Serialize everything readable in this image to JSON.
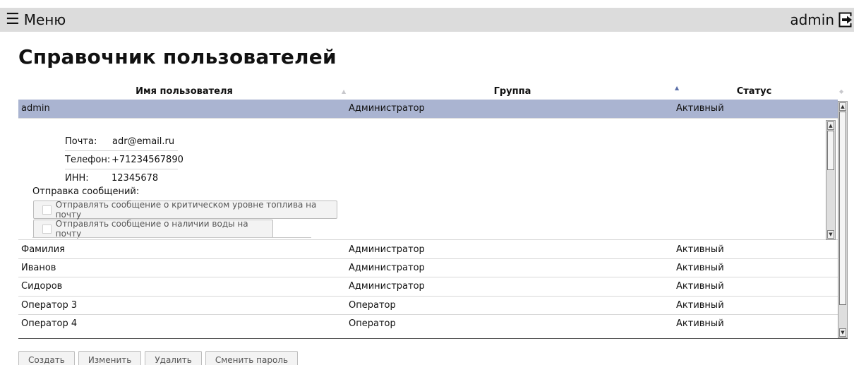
{
  "header": {
    "menu_icon": "☰",
    "menu_label": "Меню",
    "username": "admin",
    "logout_icon": "logout-icon"
  },
  "page_title": "Справочник пользователей",
  "table": {
    "columns": [
      "Имя пользователя",
      "Группа",
      "Статус"
    ],
    "sorted_by": "Статус",
    "rows": [
      {
        "name": "admin",
        "group": "Администратор",
        "status": "Активный",
        "selected": true
      },
      {
        "name": "Фамилия",
        "group": "Администратор",
        "status": "Активный"
      },
      {
        "name": "Иванов",
        "group": "Администратор",
        "status": "Активный"
      },
      {
        "name": "Сидоров",
        "group": "Администратор",
        "status": "Активный"
      },
      {
        "name": "Оператор 3",
        "group": "Оператор",
        "status": "Активный"
      },
      {
        "name": "Оператор 4",
        "group": "Оператор",
        "status": "Активный"
      }
    ]
  },
  "detail": {
    "email_label": "Почта:",
    "email_value": "adr@email.ru",
    "phone_label": "Телефон:",
    "phone_value": "+71234567890",
    "inn_label": "ИНН:",
    "inn_value": "12345678",
    "messages_label": "Отправка сообщений:",
    "checkbox_fuel": "Отправлять сообщение о критическом уровне топлива на почту",
    "checkbox_water": "Отправлять сообщение о наличии воды на почту"
  },
  "actions": {
    "create": "Создать",
    "edit": "Изменить",
    "delete": "Удалить",
    "change_password": "Сменить пароль"
  }
}
